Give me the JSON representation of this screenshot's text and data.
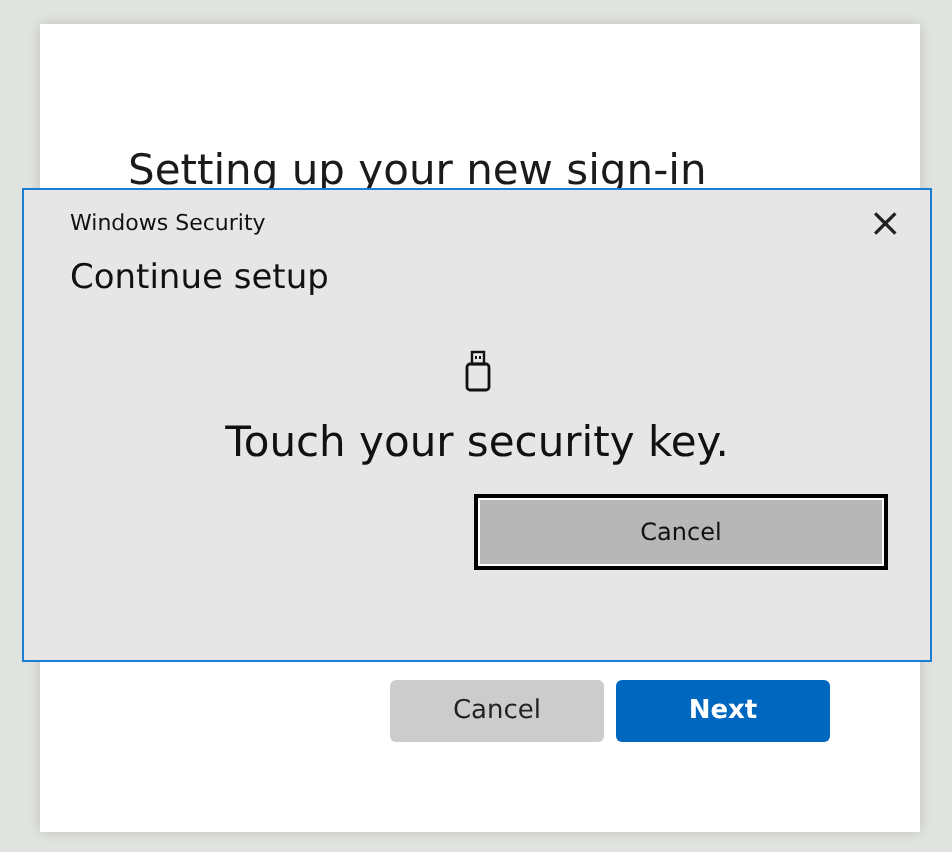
{
  "window": {
    "title": "Setting up your new sign-in",
    "buttons": [
      {
        "label": "Cancel",
        "kind": "secondary"
      },
      {
        "label": "Next",
        "kind": "primary"
      }
    ]
  },
  "dialog": {
    "title": "Windows Security",
    "close": "×",
    "heading": "Continue setup",
    "message": "Touch your security key.",
    "button": {
      "label": "Cancel",
      "focused": true
    }
  }
}
